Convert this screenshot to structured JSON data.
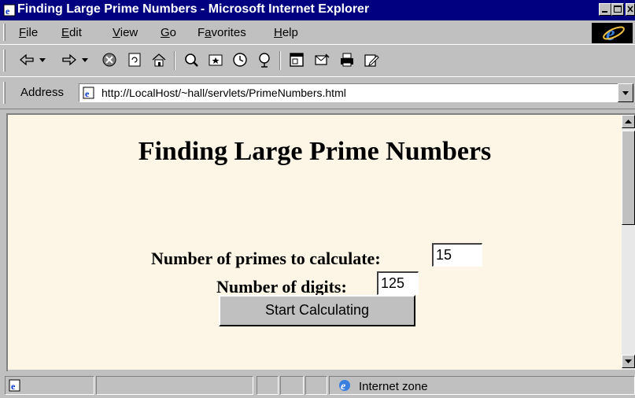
{
  "window": {
    "title": "Finding Large Prime Numbers - Microsoft Internet Explorer",
    "controls": [
      "minimize",
      "maximize",
      "close"
    ]
  },
  "menu": {
    "items": [
      {
        "label": "File",
        "accel": "F"
      },
      {
        "label": "Edit",
        "accel": "E"
      },
      {
        "label": "View",
        "accel": "V"
      },
      {
        "label": "Go",
        "accel": "G"
      },
      {
        "label": "Favorites",
        "accel": "a"
      },
      {
        "label": "Help",
        "accel": "H"
      }
    ]
  },
  "toolbar": {
    "icons": [
      "back-icon",
      "forward-icon",
      "stop-icon",
      "refresh-icon",
      "home-icon",
      "search-icon",
      "favorites-icon",
      "history-icon",
      "channels-icon",
      "fullscreen-icon",
      "mail-icon",
      "print-icon",
      "edit-icon"
    ]
  },
  "address": {
    "label": "Address",
    "url": "http://LocalHost/~hall/servlets/PrimeNumbers.html"
  },
  "page": {
    "heading": "Finding Large Prime Numbers",
    "primes_label": "Number of primes to calculate:",
    "primes_value": "15",
    "digits_label": "Number of digits:",
    "digits_value": "125",
    "button_label": "Start Calculating"
  },
  "status": {
    "zone": "Internet zone"
  },
  "colors": {
    "titlebar": "#000080",
    "chrome": "#c0c0c0",
    "page_background": "#fdf5e6"
  }
}
